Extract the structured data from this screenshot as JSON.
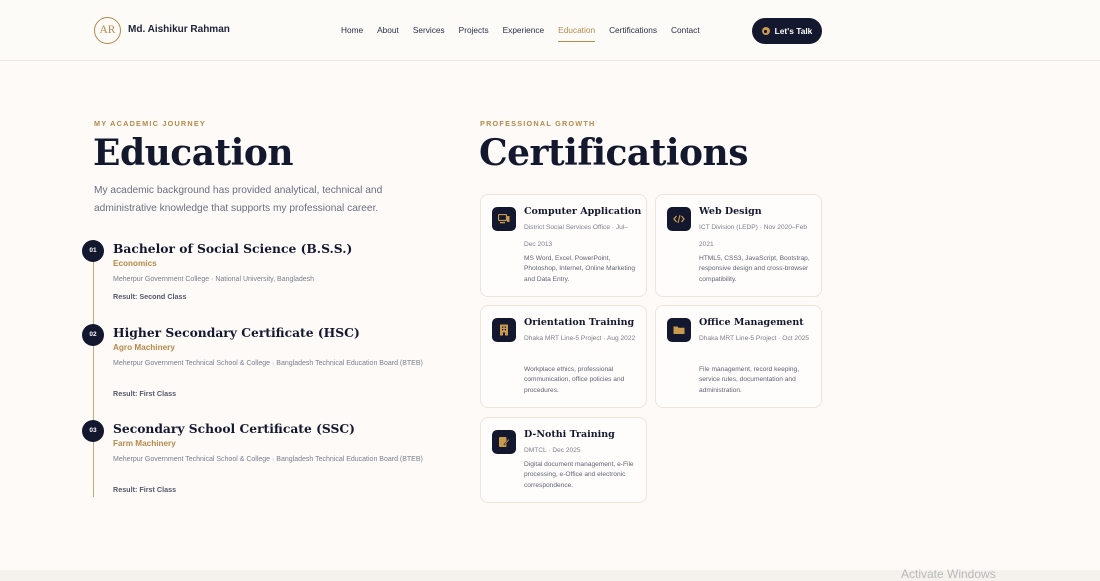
{
  "header": {
    "logo_initials": "AR",
    "name": "Md. Aishikur Rahman",
    "nav": [
      "Home",
      "About",
      "Services",
      "Projects",
      "Experience",
      "Education",
      "Certifications",
      "Contact"
    ],
    "active_nav": "Education",
    "cta_label": "Let's Talk"
  },
  "education": {
    "eyebrow": "MY ACADEMIC JOURNEY",
    "title": "Education",
    "intro": "My academic background has provided analytical, technical and administrative knowledge that supports my professional career.",
    "items": [
      {
        "number": "01",
        "degree": "Bachelor of Social Science (B.S.S.)",
        "field": "Economics",
        "institution": "Meherpur Government College · National University, Bangladesh",
        "result": "Result: Second Class"
      },
      {
        "number": "02",
        "degree": "Higher Secondary Certificate (HSC)",
        "field": "Agro Machinery",
        "institution": "Meherpur Government Technical School & College · Bangladesh Technical Education Board (BTEB)",
        "result": "Result: First Class"
      },
      {
        "number": "03",
        "degree": "Secondary School Certificate (SSC)",
        "field": "Farm Machinery",
        "institution": "Meherpur Government Technical School & College · Bangladesh Technical Education Board (BTEB)",
        "result": "Result: First Class"
      }
    ]
  },
  "certifications": {
    "eyebrow": "PROFESSIONAL GROWTH",
    "title": "Certifications",
    "items": [
      {
        "icon": "computer-icon",
        "title": "Computer Application",
        "meta": "District Social Services Office · Jul–Dec 2013",
        "description": "MS Word, Excel, PowerPoint, Photoshop, Internet, Online Marketing and Data Entry."
      },
      {
        "icon": "code-icon",
        "title": "Web Design",
        "meta": "ICT Division (LEDP) · Nov 2020–Feb 2021",
        "description": "HTML5, CSS3, JavaScript, Bootstrap, responsive design and cross-browser compatibility."
      },
      {
        "icon": "building-icon",
        "title": "Orientation Training",
        "meta": "Dhaka MRT Line-5 Project · Aug 2022",
        "description": "Workplace ethics, professional communication, office policies and procedures."
      },
      {
        "icon": "folder-icon",
        "title": "Office Management",
        "meta": "Dhaka MRT Line-5 Project · Oct 2025",
        "description": "File management, record keeping, service rules, documentation and administration."
      },
      {
        "icon": "file-edit-icon",
        "title": "D-Nothi Training",
        "meta": "DMTCL · Dec 2025",
        "description": "Digital document management, e-File processing, e-Office and electronic correspondence."
      }
    ]
  },
  "system_watermark": "Activate Windows",
  "colors": {
    "accent": "#b58a4a",
    "navy": "#13182e",
    "background": "#fdfaf7"
  }
}
